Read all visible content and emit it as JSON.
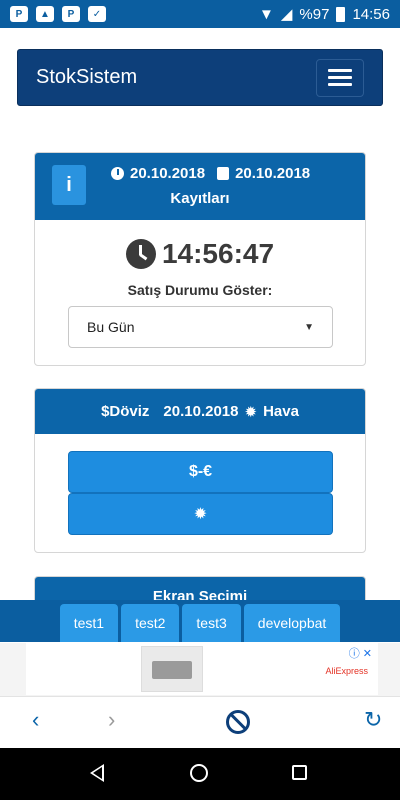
{
  "status_bar": {
    "battery_percent": "%97",
    "time": "14:56"
  },
  "app": {
    "brand": "StokSistem"
  },
  "card_records": {
    "date_from": "20.10.2018",
    "date_to": "20.10.2018",
    "title": "Kayıtları",
    "clock_time": "14:56:47",
    "status_label": "Satış Durumu Göster:",
    "select_value": "Bu Gün"
  },
  "card_currency": {
    "currency_label": "$Döviz",
    "date": "20.10.2018",
    "weather_label": "Hava",
    "button_currency": "$-€",
    "button_weather_icon": "sun-icon"
  },
  "card_screen": {
    "title": "Ekran Seçimi"
  },
  "tabs": [
    {
      "label": "test1"
    },
    {
      "label": "test2"
    },
    {
      "label": "test3"
    },
    {
      "label": "developbat"
    }
  ],
  "ad": {
    "brand": "AliExpress"
  },
  "colors": {
    "primary": "#0c65a9",
    "navbar": "#0d3f7a",
    "button": "#1e8de0"
  }
}
